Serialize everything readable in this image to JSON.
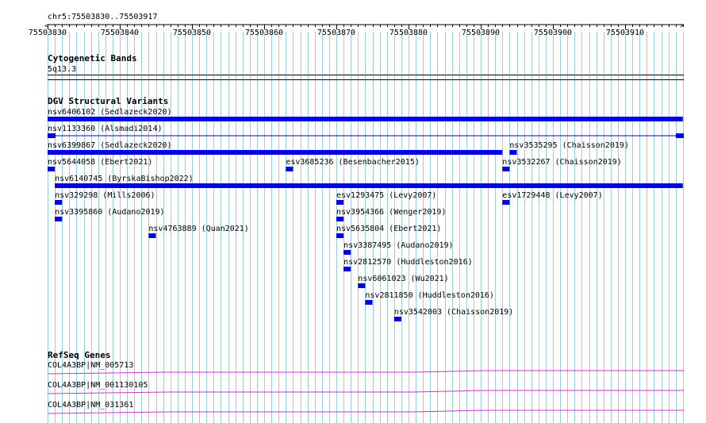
{
  "view": {
    "range_label": "chr5:75503830..75503917",
    "start": 75503830,
    "end": 75503918
  },
  "ruler": {
    "tick_labels": [
      "75503830",
      "75503840",
      "75503850",
      "75503860",
      "75503870",
      "75503880",
      "75503890",
      "75503900",
      "75503910"
    ]
  },
  "tracks": {
    "cytoband": {
      "title": "Cytogenetic Bands",
      "bands": [
        {
          "label": "5q13.3"
        }
      ]
    },
    "dgv": {
      "title": "DGV Structural Variants",
      "color": "#0000e6",
      "features": [
        {
          "label": "nsv6406102 (Sedlazeck2020)",
          "start": 75503830,
          "end": 75503918
        },
        {
          "label": "nsv1133360 (Alsmadi2014)",
          "start": 75503830,
          "end": 75503918,
          "thin": true
        },
        {
          "label": "nsv6399867 (Sedlazeck2020)",
          "start": 75503830,
          "end": 75503893
        },
        {
          "label": "nsv3535295 (Chaisson2019)",
          "start": 75503894,
          "end": 75503895
        },
        {
          "label": "nsv5644058 (Ebert2021)",
          "start": 75503830,
          "end": 75503831
        },
        {
          "label": "esv3685236 (Besenbacher2015)",
          "start": 75503863,
          "end": 75503864
        },
        {
          "label": "nsv3532267 (Chaisson2019)",
          "start": 75503893,
          "end": 75503894
        },
        {
          "label": "nsv6140745 (ByrskaBishop2022)",
          "start": 75503831,
          "end": 75503918
        },
        {
          "label": "nsv329298 (Mills2006)",
          "start": 75503831,
          "end": 75503832
        },
        {
          "label": "esv1293475 (Levy2007)",
          "start": 75503870,
          "end": 75503871
        },
        {
          "label": "esv1729448 (Levy2007)",
          "start": 75503893,
          "end": 75503894
        },
        {
          "label": "nsv3395860 (Audano2019)",
          "start": 75503831,
          "end": 75503832
        },
        {
          "label": "nsv3954366 (Wenger2019)",
          "start": 75503870,
          "end": 75503871
        },
        {
          "label": "nsv4763889 (Quan2021)",
          "start": 75503844,
          "end": 75503845
        },
        {
          "label": "nsv5635804 (Ebert2021)",
          "start": 75503870,
          "end": 75503871
        },
        {
          "label": "nsv3387495 (Audano2019)",
          "start": 75503871,
          "end": 75503872
        },
        {
          "label": "nsv2812570 (Huddleston2016)",
          "start": 75503871,
          "end": 75503872
        },
        {
          "label": "nsv6061023 (Wu2021)",
          "start": 75503873,
          "end": 75503874
        },
        {
          "label": "nsv2811850 (Huddleston2016)",
          "start": 75503874,
          "end": 75503875
        },
        {
          "label": "nsv3542003 (Chaisson2019)",
          "start": 75503878,
          "end": 75503879
        }
      ]
    },
    "refseq": {
      "title": "RefSeq Genes",
      "color": "#cc33cc",
      "genes": [
        {
          "label": "COL4A3BP|NM_005713"
        },
        {
          "label": "COL4A3BP|NM_001130105"
        },
        {
          "label": "COL4A3BP|NM_031361"
        }
      ]
    }
  }
}
